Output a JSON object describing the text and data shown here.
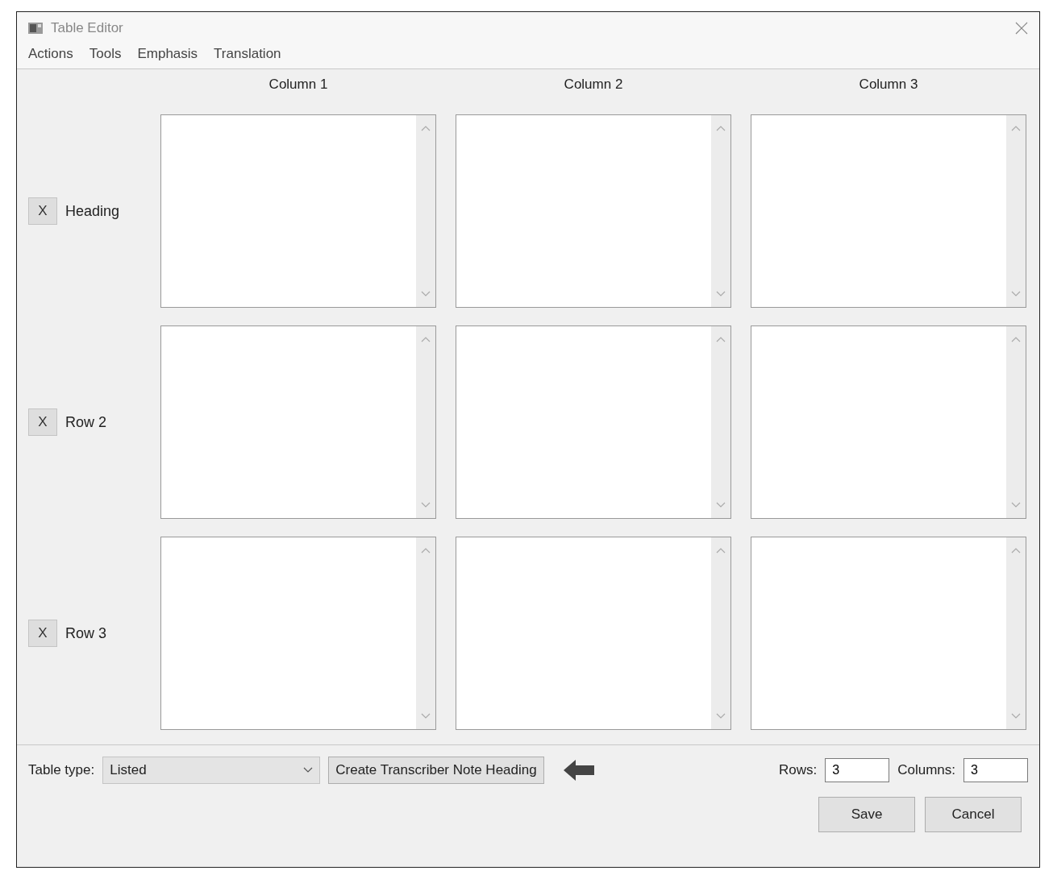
{
  "window": {
    "title": "Table Editor"
  },
  "menu": [
    "Actions",
    "Tools",
    "Emphasis",
    "Translation"
  ],
  "columns": [
    "Column 1",
    "Column 2",
    "Column 3"
  ],
  "rows": [
    {
      "delete": "X",
      "label": "Heading"
    },
    {
      "delete": "X",
      "label": "Row 2"
    },
    {
      "delete": "X",
      "label": "Row 3"
    }
  ],
  "footer": {
    "table_type_label": "Table type:",
    "table_type": "Listed",
    "note_button": "Create Transcriber Note Heading",
    "rows_label": "Rows:",
    "rows_value": "3",
    "columns_label": "Columns:",
    "columns_value": "3"
  },
  "buttons": [
    "Save",
    "Cancel"
  ]
}
